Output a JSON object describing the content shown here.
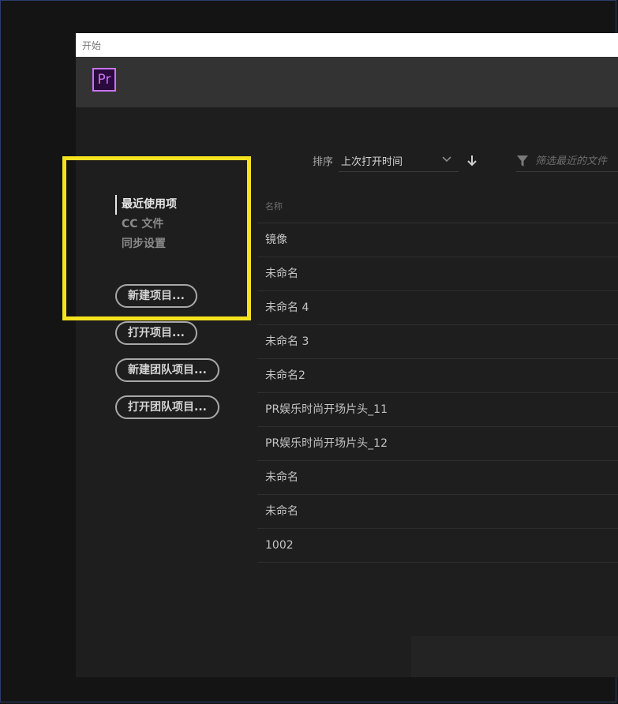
{
  "window": {
    "title": "开始"
  },
  "header": {
    "logo_text": "Pr"
  },
  "nav": {
    "items": [
      {
        "label": "最近使用项"
      },
      {
        "label": "CC 文件"
      },
      {
        "label": "同步设置"
      }
    ]
  },
  "actions": {
    "new_project": "新建项目...",
    "open_project": "打开项目...",
    "new_team_project": "新建团队项目...",
    "open_team_project": "打开团队项目..."
  },
  "sort": {
    "label": "排序",
    "value": "上次打开时间",
    "direction_icon": "arrow-down-icon"
  },
  "filter": {
    "placeholder": "筛选最近的文件"
  },
  "recent_files": {
    "column_header": "名称",
    "rows": [
      "镜像",
      "未命名",
      "未命名 4",
      "未命名 3",
      "未命名2",
      "PR娱乐时尚开场片头_11",
      "PR娱乐时尚开场片头_12",
      "未命名",
      "未命名",
      "1002"
    ]
  },
  "colors": {
    "highlight": "#f5e320",
    "premiere_purple": "#c774f5",
    "dialog_bg": "#1e1e1e"
  }
}
